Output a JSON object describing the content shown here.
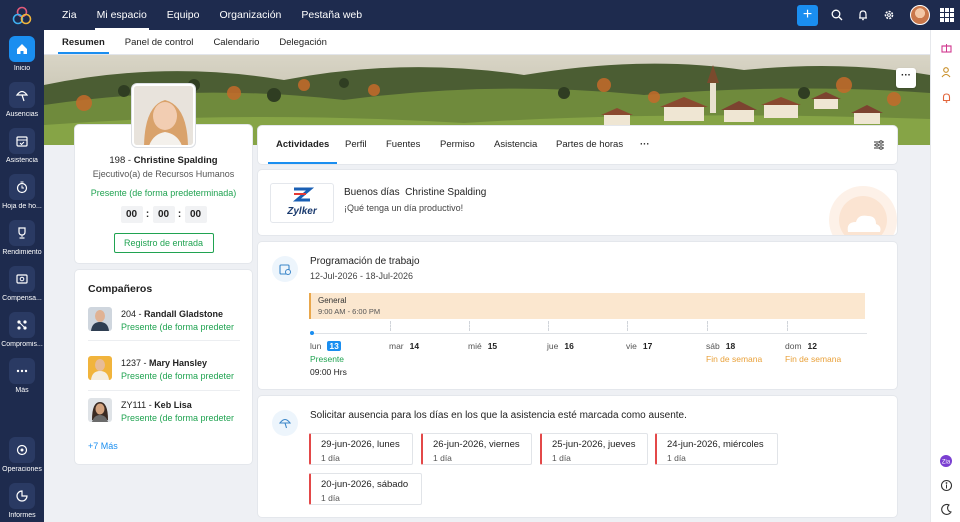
{
  "topnav": {
    "items": [
      "Zia",
      "Mi espacio",
      "Equipo",
      "Organización",
      "Pestaña web"
    ],
    "active": "Mi espacio"
  },
  "subnav": {
    "items": [
      "Resumen",
      "Panel de control",
      "Calendario",
      "Delegación"
    ],
    "active": "Resumen"
  },
  "rail": {
    "items": [
      {
        "label": "Inicio",
        "icon": "home-icon"
      },
      {
        "label": "Ausencias",
        "icon": "beach-umbrella-icon"
      },
      {
        "label": "Asistencia",
        "icon": "calendar-icon"
      },
      {
        "label": "Hoja de ho...",
        "icon": "timesheet-icon"
      },
      {
        "label": "Rendimiento",
        "icon": "trophy-icon"
      },
      {
        "label": "Compensa...",
        "icon": "compensation-icon"
      },
      {
        "label": "Compromis...",
        "icon": "engagement-icon"
      },
      {
        "label": "Más",
        "icon": "more-dots-icon"
      },
      {
        "label": "Operaciones",
        "icon": "operations-icon"
      },
      {
        "label": "Informes",
        "icon": "reports-icon"
      }
    ]
  },
  "profile": {
    "id": "198",
    "separator": " - ",
    "name": "Christine Spalding",
    "role": "Ejecutivo(a) de Recursos Humanos",
    "status": "Presente (de forma predeterminada)",
    "timer": [
      "00",
      "00",
      "00"
    ],
    "checkin_label": "Registro de entrada"
  },
  "colleagues": {
    "title": "Compañeros",
    "items": [
      {
        "id": "204",
        "name": "Randall Gladstone",
        "status": "Presente (de forma predeter"
      },
      {
        "id": "1237",
        "name": "Mary Hansley",
        "status": "Presente (de forma predeter"
      },
      {
        "id": "ZY111",
        "name": "Keb Lisa",
        "status": "Presente (de forma predeter"
      }
    ],
    "more": "+7 Más"
  },
  "tabs": {
    "items": [
      "Actividades",
      "Perfil",
      "Fuentes",
      "Permiso",
      "Asistencia",
      "Partes de horas",
      "···"
    ],
    "active": "Actividades"
  },
  "greeting": {
    "hello": "Buenos días",
    "name": "Christine Spalding",
    "message": "¡Qué tenga un día productivo!",
    "logo_text": "Zylker"
  },
  "schedule": {
    "title": "Programación de trabajo",
    "range": "12-Jul-2026   -   18-Jul-2026",
    "shift_name": "General",
    "shift_hours": "9:00 AM - 6:00 PM",
    "days": [
      {
        "name": "lun",
        "date": "13",
        "status": "Presente",
        "hours": "09:00 Hrs",
        "today": true
      },
      {
        "name": "mar",
        "date": "14",
        "status": ""
      },
      {
        "name": "mié",
        "date": "15",
        "status": ""
      },
      {
        "name": "jue",
        "date": "16",
        "status": ""
      },
      {
        "name": "vie",
        "date": "17",
        "status": ""
      },
      {
        "name": "sáb",
        "date": "18",
        "status": "Fin de semana"
      },
      {
        "name": "dom",
        "date": "12",
        "status": "Fin de semana"
      }
    ]
  },
  "leave": {
    "title": "Solicitar ausencia para los días en los que la asistencia esté marcada como ausente.",
    "dates": [
      {
        "date": "29-jun-2026, lunes",
        "dur": "1 día"
      },
      {
        "date": "26-jun-2026, viernes",
        "dur": "1 día"
      },
      {
        "date": "25-jun-2026, jueves",
        "dur": "1 día"
      },
      {
        "date": "24-jun-2026, miércoles",
        "dur": "1 día"
      },
      {
        "date": "20-jun-2026, sábado",
        "dur": "1 día"
      }
    ]
  },
  "colors": {
    "nav": "#1e2b4e",
    "accent": "#1a8ef0",
    "present": "#20a351",
    "weekend": "#e9a13a",
    "absent": "#e34848"
  }
}
